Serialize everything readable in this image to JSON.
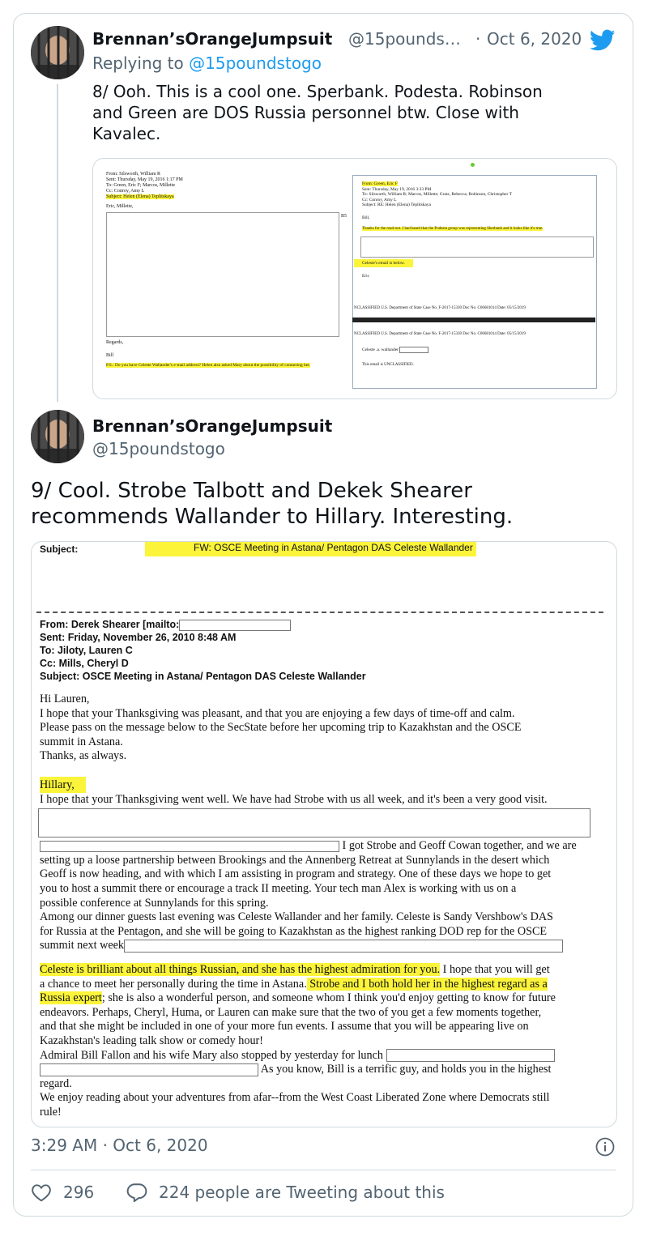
{
  "tweet1": {
    "display_name": "Brennan’sOrangeJumpsuit",
    "handle": "@15pounds…",
    "separator": "·",
    "date": "Oct 6, 2020",
    "replying_prefix": "Replying to",
    "replying_handle": "@15poundstogo",
    "text_line1": "8/ Ooh.  This is a cool one.  Sperbank.  Podesta.  Robinson",
    "text_line2": "and Green are DOS Russia personnel btw.  Close with",
    "text_line3": "Kavalec.",
    "doc_left": {
      "from": "From: Silsworth, William R",
      "sent": "Sent: Thursday, May 19, 2016 1:17 PM",
      "to": "To: Green, Eric F; Marcos, Millette",
      "cc": "Cc: Conroy, Amy L",
      "subject": "Subject: Helen (Elena) Teplitskaya",
      "greeting": "Eric, Millette,",
      "regards": "Regards,",
      "sign": "Bill",
      "ps": "P.S.: Do you have Celeste Wallander's e-mail address? Helen also asked Mary about the possibility of contacting her.",
      "b5": "B5"
    },
    "doc_right": {
      "from": "From: Green, Eric F",
      "sent": "Sent: Thursday, May 19, 2016 3:33 PM",
      "to": "To: Silsworth, William R; Marcos, Millette; Gratz, Rebecca; Robinson, Christopher T",
      "cc": "Cc: Conroy, Amy L",
      "subject": "Subject: RE: Helen (Elena) Teplitskaya",
      "greeting": "Bill,",
      "thanks": "Thanks for the read-out.  I had heard that the Podesta group was representing Sberbank and it looks like it's true.",
      "celeste_email": "Celeste's email is below.",
      "sign": "Eric",
      "unclass1": "NCLASSIFIED  U.S. Department of State  Case No. F-2017-15330  Doc No. C06681014  Date: 05/15/2019",
      "unclass2": "NCLASSIFIED  U.S. Department of State  Case No. F-2017-15330  Doc No. C06681014  Date: 05/15/2019",
      "celeste_addr": "Celeste .a. wallander",
      "footer": "This email is UNCLASSIFIED."
    }
  },
  "tweet2": {
    "display_name": "Brennan’sOrangeJumpsuit",
    "handle": "@15poundstogo",
    "text_line1": "9/ Cool.  Strobe Talbott and Dekek Shearer",
    "text_line2": "recommends Wallander to Hillary.  Interesting.",
    "doc": {
      "subject_label": "Subject:",
      "subject_value": "FW: OSCE Meeting in Astana/ Pentagon DAS Celeste Wallander",
      "from": "From: Derek Shearer [mailto:",
      "sent": "Sent: Friday, November 26, 2010 8:48 AM",
      "to": "To: Jiloty, Lauren C",
      "cc": "Cc: Mills, Cheryl D",
      "subject2": "Subject: OSCE Meeting in Astana/ Pentagon DAS Celeste Wallander",
      "p1": "Hi Lauren,",
      "p2": "I hope that your Thanksgiving was pleasant, and that you are enjoying a few days of time-off and calm.",
      "p3": "Please pass on the message below to the SecState before her upcoming trip to Kazakhstan and the OSCE",
      "p4": "summit in Astana.",
      "p5": "Thanks, as always.",
      "hillary": "Hillary,",
      "h1": "I hope that your Thanksgiving went well. We have had Strobe with us all week, and it's been a very good visit.",
      "h2": "I got Strobe and Geoff Cowan together, and we are",
      "h3": "setting up a loose partnership between Brookings and the Annenberg Retreat at Sunnylands in the desert which",
      "h4": "Geoff is now heading, and with which I am assisting in program and strategy. One of these days we hope to get",
      "h5": "you to host a summit there or encourage a track II meeting. Your tech man Alex is working with us on a",
      "h6": "possible conference at Sunnylands for this spring.",
      "h7": "Among our dinner guests last evening was Celeste Wallander and her family. Celeste is Sandy Vershbow's DAS",
      "h8": "for Russia at the Pentagon, and she will be going to Kazakhstan as the highest ranking DOD rep for the OSCE",
      "h9": "summit next week",
      "c1a": "Celeste is brilliant about all things Russian, and she has the highest admiration for you.",
      "c1b": " I hope that you will get",
      "c2a": "a chance to meet her personally during the time in Astana.",
      "c2b": " Strobe and I both hold her in the highest regard as a",
      "c3a": "Russia expert",
      "c3b": "; she is also a wonderful person, and someone whom I think you'd enjoy getting to know for future",
      "c4": "endeavors. Perhaps, Cheryl, Huma, or Lauren can make sure that the two of you get a few moments together,",
      "c5": "and that she might be included in one of your more fun events. I assume that you will be appearing live on",
      "c6": "Kazakhstan's leading talk show or comedy hour!",
      "c7": "Admiral Bill Fallon and his wife Mary also stopped by yesterday for lunch",
      "c8": "As you know, Bill is a terrific guy, and holds you in the highest",
      "c9": "regard.",
      "c10": "We enjoy reading about your adventures from afar--from the West Coast Liberated Zone where Democrats still",
      "c11": "rule!"
    }
  },
  "footer": {
    "timestamp": "3:29 AM · Oct 6, 2020",
    "like_count": "296",
    "reply_text": "224 people are Tweeting about this"
  },
  "icons": {
    "bird": "twitter-bird-icon",
    "info": "info-icon",
    "heart": "heart-icon",
    "comment": "comment-icon"
  },
  "colors": {
    "accent": "#1d9bf0",
    "secondary_text": "#536471",
    "border": "#cfd9de",
    "highlight": "#fbf43a"
  }
}
